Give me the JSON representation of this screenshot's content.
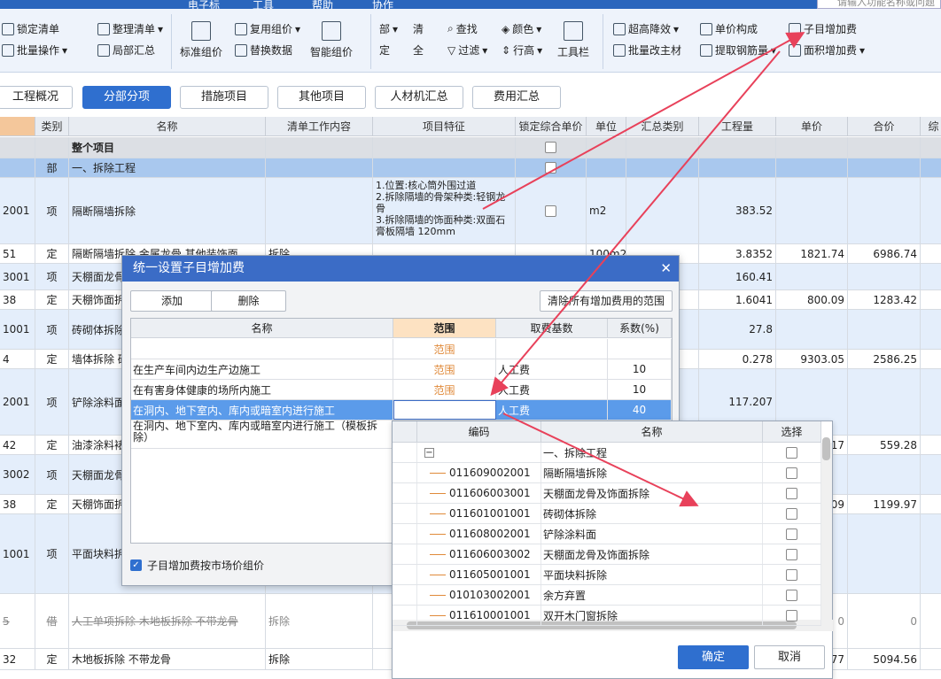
{
  "menu": {
    "items": [
      "电子标",
      "工具",
      "帮助",
      "协作"
    ],
    "search_placeholder": "请输入功能名称或问题"
  },
  "ribbon": {
    "lock_list": "锁定清单",
    "organize_list": "整理清单",
    "batch_ops": "批量操作",
    "partial_summary": "局部汇总",
    "standard_price": "标准组价",
    "reuse_price": "复用组价",
    "replace_data": "替换数据",
    "smart_price": "智能组价",
    "pin_top": "部",
    "list_char": "清",
    "fix_char": "定",
    "all_char": "全",
    "find": "查找",
    "color": "颜色",
    "filter": "过滤",
    "row_height": "行高",
    "toolbar": "工具栏",
    "super_height": "超高降效",
    "unit_price_comp": "单价构成",
    "sub_item_fee": "子目增加费",
    "batch_main_material": "批量改主材",
    "extract_rebar": "提取钢筋量",
    "area_fee": "面积增加费"
  },
  "tabs": [
    "工程概况",
    "分部分项",
    "措施项目",
    "其他项目",
    "人材机汇总",
    "费用汇总"
  ],
  "grid": {
    "headers": [
      "",
      "类别",
      "名称",
      "清单工作内容",
      "项目特征",
      "锁定综合单价",
      "单位",
      "汇总类别",
      "工程量",
      "单价",
      "合价",
      "综"
    ],
    "rows": [
      {
        "code": "",
        "type": "",
        "name": "整个项目",
        "content": "",
        "feature": "",
        "unit": "",
        "qty": "",
        "price": "",
        "total": ""
      },
      {
        "code": "",
        "type": "部",
        "name": "一、拆除工程",
        "content": "",
        "feature": "",
        "unit": "",
        "qty": "",
        "price": "",
        "total": ""
      },
      {
        "code": "2001",
        "type": "项",
        "name": "隔断隔墙拆除",
        "content": "",
        "feature": "1.位置:核心筒外围过道\n2.拆除隔墙的骨架种类:轻钢龙骨\n3.拆除隔墙的饰面种类:双面石膏板隔墙 120mm",
        "unit": "m2",
        "qty": "383.52",
        "price": "",
        "total": ""
      },
      {
        "code": "51",
        "type": "定",
        "name": "隔断隔墙拆除 金属龙骨 其他装饰面",
        "content": "拆除",
        "feature": "",
        "unit": "100m2",
        "qty": "3.8352",
        "price": "1821.74",
        "total": "6986.74"
      },
      {
        "code": "3001",
        "type": "项",
        "name": "天棚面龙骨及饰面拆除",
        "content": "",
        "feature": "",
        "unit": "",
        "qty": "160.41",
        "price": "",
        "total": ""
      },
      {
        "code": "38",
        "type": "定",
        "name": "天棚饰面拆除",
        "content": "",
        "feature": "",
        "unit": "",
        "qty": "1.6041",
        "price": "800.09",
        "total": "1283.42"
      },
      {
        "code": "1001",
        "type": "项",
        "name": "砖砌体拆除",
        "content": "",
        "feature": "",
        "unit": "",
        "qty": "27.8",
        "price": "",
        "total": ""
      },
      {
        "code": "4",
        "type": "定",
        "name": "墙体拆除 砖墙",
        "content": "",
        "feature": "",
        "unit": "",
        "qty": "0.278",
        "price": "9303.05",
        "total": "2586.25"
      },
      {
        "code": "2001",
        "type": "项",
        "name": "铲除涂料面",
        "content": "",
        "feature": "",
        "unit": "",
        "qty": "117.207",
        "price": "",
        "total": ""
      },
      {
        "code": "42",
        "type": "定",
        "name": "油漆涂料裱糊面拆除",
        "content": "",
        "feature": "",
        "unit": "",
        "qty": "",
        "price": "17",
        "total": "559.28"
      },
      {
        "code": "3002",
        "type": "项",
        "name": "天棚面龙骨及饰面拆除",
        "content": "",
        "feature": "",
        "unit": "",
        "qty": "",
        "price": "",
        "total": ""
      },
      {
        "code": "38",
        "type": "定",
        "name": "天棚饰面拆除",
        "content": "",
        "feature": "",
        "unit": "",
        "qty": "",
        "price": "09",
        "total": "1199.97"
      },
      {
        "code": "1001",
        "type": "项",
        "name": "平面块料拆除",
        "content": "",
        "feature": "至3",
        "unit": "",
        "qty": "",
        "price": "",
        "total": ""
      },
      {
        "code": "5",
        "type": "借",
        "name": "人工单项拆除 木地板拆除 不带龙骨",
        "content": "拆除",
        "feature": "",
        "unit": "",
        "qty": "",
        "price": "0",
        "total": "0"
      },
      {
        "code": "32",
        "type": "定",
        "name": "木地板拆除 不带龙骨",
        "content": "拆除",
        "feature": "",
        "unit": "",
        "qty": "",
        "price": "77",
        "total": "5094.56"
      }
    ]
  },
  "dialog": {
    "title": "统一设置子目增加费",
    "add": "添加",
    "delete": "删除",
    "clear_range": "清除所有增加费用的范围",
    "headers": [
      "名称",
      "范围",
      "取费基数",
      "系数(%)"
    ],
    "rows": [
      {
        "name": "",
        "range": "范围",
        "base": "",
        "coef": ""
      },
      {
        "name": "在生产车间内边生产边施工",
        "range": "范围",
        "base": "人工费",
        "coef": "10"
      },
      {
        "name": "在有害身体健康的场所内施工",
        "range": "范围",
        "base": "人工费",
        "coef": "10"
      },
      {
        "name": "在洞内、地下室内、库内或暗室内进行施工",
        "range": "",
        "base": "人工费",
        "coef": "40"
      },
      {
        "name": "在洞内、地下室内、库内或暗室内进行施工（模板拆除）",
        "range": "",
        "base": "",
        "coef": ""
      }
    ],
    "checkbox_label": "子目增加费按市场价组价"
  },
  "popup": {
    "headers": [
      "编码",
      "名称",
      "选择"
    ],
    "rows": [
      {
        "code": "",
        "name": "一、拆除工程"
      },
      {
        "code": "011609002001",
        "name": "隔断隔墙拆除"
      },
      {
        "code": "011606003001",
        "name": "天棚面龙骨及饰面拆除"
      },
      {
        "code": "011601001001",
        "name": "砖砌体拆除"
      },
      {
        "code": "011608002001",
        "name": "铲除涂料面"
      },
      {
        "code": "011606003002",
        "name": "天棚面龙骨及饰面拆除"
      },
      {
        "code": "011605001001",
        "name": "平面块料拆除"
      },
      {
        "code": "010103002001",
        "name": "余方弃置"
      },
      {
        "code": "011610001001",
        "name": "双开木门窗拆除"
      }
    ],
    "ok": "确定",
    "cancel": "取消"
  },
  "colors": {
    "accent": "#2f6fcf",
    "title_bar": "#3b6cc6",
    "arrow": "#e8415a",
    "range_text": "#e08a3a",
    "selected_row": "#5b9bea"
  }
}
